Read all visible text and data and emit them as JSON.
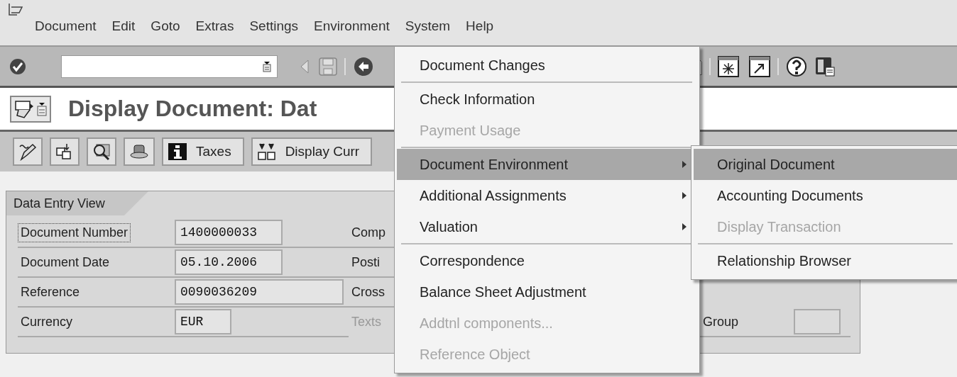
{
  "menubar": {
    "items": [
      {
        "label": "Document"
      },
      {
        "label": "Edit"
      },
      {
        "label": "Goto"
      },
      {
        "label": "Extras"
      },
      {
        "label": "Settings"
      },
      {
        "label": "Environment"
      },
      {
        "label": "System"
      },
      {
        "label": "Help"
      }
    ]
  },
  "title": "Display Document: Dat",
  "app_toolbar": {
    "buttons": [
      {
        "kind": "icon"
      },
      {
        "kind": "icon"
      },
      {
        "kind": "icon"
      },
      {
        "kind": "icon"
      },
      {
        "kind": "text",
        "label": "Taxes"
      },
      {
        "kind": "text",
        "label": "Display Curr"
      }
    ]
  },
  "tab": {
    "label": "Data Entry View"
  },
  "fields": [
    {
      "label": "Document Number",
      "value": "1400000033",
      "focused": true
    },
    {
      "label": "Document Date",
      "value": "05.10.2006",
      "focused": false
    },
    {
      "label": "Reference",
      "value": "0090036209",
      "focused": false
    },
    {
      "label": "Currency",
      "value": "EUR",
      "focused": false
    }
  ],
  "right_labels": [
    {
      "label": "Comp",
      "disabled": false
    },
    {
      "label": "Posti",
      "disabled": false
    },
    {
      "label": "Cross",
      "disabled": false
    },
    {
      "label": "Texts",
      "disabled": true
    }
  ],
  "group_field": {
    "label": "Group"
  },
  "menu": {
    "items": [
      {
        "kind": "item",
        "label": "Document Changes",
        "disabled": false,
        "selected": false,
        "submenu": false
      },
      {
        "kind": "separator"
      },
      {
        "kind": "item",
        "label": "Check Information",
        "disabled": false,
        "selected": false,
        "submenu": false
      },
      {
        "kind": "item",
        "label": "Payment Usage",
        "disabled": true,
        "selected": false,
        "submenu": false
      },
      {
        "kind": "separator"
      },
      {
        "kind": "item",
        "label": "Document Environment",
        "disabled": false,
        "selected": true,
        "submenu": true
      },
      {
        "kind": "item",
        "label": "Additional Assignments",
        "disabled": false,
        "selected": false,
        "submenu": true
      },
      {
        "kind": "item",
        "label": "Valuation",
        "disabled": false,
        "selected": false,
        "submenu": true
      },
      {
        "kind": "separator"
      },
      {
        "kind": "item",
        "label": "Correspondence",
        "disabled": false,
        "selected": false,
        "submenu": false
      },
      {
        "kind": "item",
        "label": "Balance Sheet Adjustment",
        "disabled": false,
        "selected": false,
        "submenu": false
      },
      {
        "kind": "item",
        "label": "Addtnl components...",
        "disabled": true,
        "selected": false,
        "submenu": false
      },
      {
        "kind": "item",
        "label": "Reference Object",
        "disabled": true,
        "selected": false,
        "submenu": false
      }
    ]
  },
  "submenu": {
    "items": [
      {
        "kind": "item",
        "label": "Original Document",
        "disabled": false,
        "selected": true,
        "submenu": false
      },
      {
        "kind": "item",
        "label": "Accounting Documents",
        "disabled": false,
        "selected": false,
        "submenu": false
      },
      {
        "kind": "item",
        "label": "Display Transaction",
        "disabled": true,
        "selected": false,
        "submenu": false
      },
      {
        "kind": "separator"
      },
      {
        "kind": "item",
        "label": "Relationship Browser",
        "disabled": false,
        "selected": false,
        "submenu": false
      }
    ]
  }
}
